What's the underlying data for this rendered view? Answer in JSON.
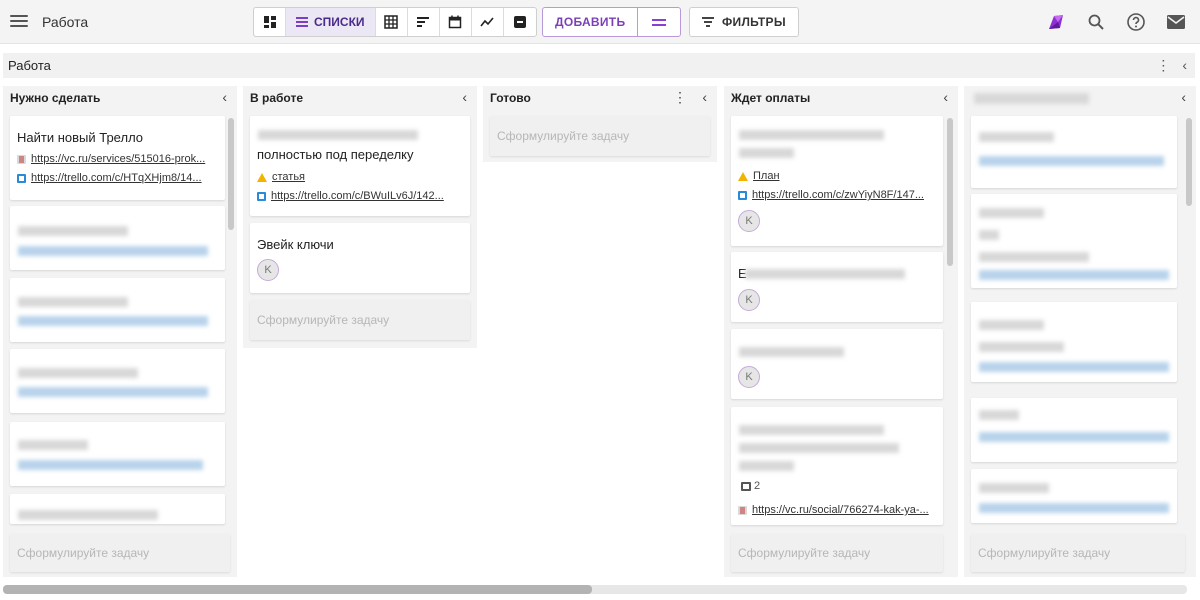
{
  "app": {
    "title": "Работа",
    "views": {
      "lists_label": "СПИСКИ"
    },
    "add_label": "ДОБАВИТЬ",
    "filters_label": "ФИЛЬТРЫ"
  },
  "board": {
    "title": "Работа"
  },
  "columns": [
    {
      "title": "Нужно сделать",
      "cards": [
        {
          "title": "Найти новый Трелло",
          "links": [
            "https://vc.ru/services/515016-prok...",
            "https://trello.com/c/HTqXHjm8/14..."
          ]
        }
      ],
      "placeholder": "Сформулируйте задачу"
    },
    {
      "title": "В работе",
      "cards": [
        {
          "title": "полностью под переделку",
          "drive_link": "статья",
          "trello_link": "https://trello.com/c/BWuILv6J/142..."
        },
        {
          "title": "Эвейк ключи",
          "avatar": "K"
        }
      ],
      "placeholder": "Сформулируйте задачу"
    },
    {
      "title": "Готово",
      "placeholder": "Сформулируйте задачу"
    },
    {
      "title": "Ждет оплаты",
      "cards": [
        {
          "drive_link": "План",
          "trello_link": "https://trello.com/c/zwYiyN8F/147...",
          "avatar": "K"
        },
        {
          "title_prefix": "E",
          "avatar": "K"
        },
        {
          "avatar": "K"
        },
        {
          "comments": "2",
          "vc_link": "https://vc.ru/social/766274-kak-ya-..."
        }
      ],
      "placeholder": "Сформулируйте задачу"
    },
    {
      "title": "",
      "placeholder": "Сформулируйте задачу"
    }
  ]
}
